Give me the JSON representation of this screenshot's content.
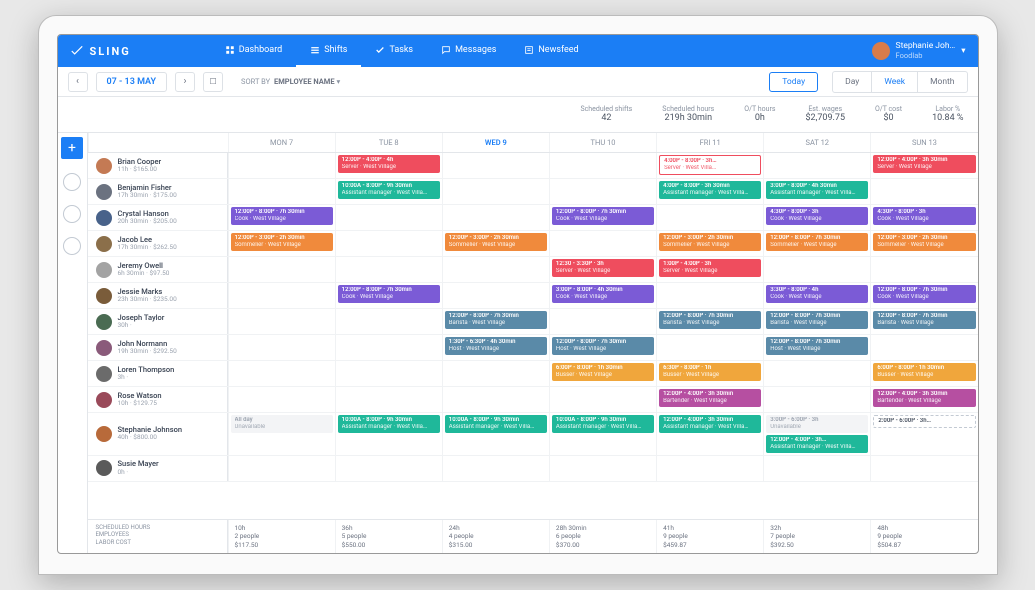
{
  "brand": "SLING",
  "nav": {
    "dashboard": "Dashboard",
    "shifts": "Shifts",
    "tasks": "Tasks",
    "messages": "Messages",
    "newsfeed": "Newsfeed"
  },
  "user": {
    "name": "Stephanie Joh…",
    "org": "Foodlab"
  },
  "toolbar": {
    "range": "07 - 13 MAY",
    "sort_label": "SORT BY",
    "sort_value": "EMPLOYEE NAME",
    "today": "Today",
    "day": "Day",
    "week": "Week",
    "month": "Month"
  },
  "stats": [
    {
      "label": "Scheduled shifts",
      "value": "42"
    },
    {
      "label": "Scheduled hours",
      "value": "219h 30min"
    },
    {
      "label": "O/T hours",
      "value": "0h"
    },
    {
      "label": "Est. wages",
      "value": "$2,709.75"
    },
    {
      "label": "O/T cost",
      "value": "$0"
    },
    {
      "label": "Labor %",
      "value": "10.84 %"
    }
  ],
  "days": [
    "MON 7",
    "TUE 8",
    "WED 9",
    "THU 10",
    "FRI 11",
    "SAT 12",
    "SUN 13"
  ],
  "colors": {
    "server": "#ef4d5e",
    "asst": "#1fb89a",
    "cook": "#7b5bd6",
    "somm": "#f08a3c",
    "barista": "#5a8aa8",
    "host": "#5a8aa8",
    "busser": "#f0a63c",
    "bartender": "#b64fa1"
  },
  "employees": [
    {
      "name": "Brian Cooper",
      "sub": "11h · $165.00",
      "av": "#c47a54",
      "cells": [
        [],
        [
          {
            "t": "12:00P - 4:00P · 4h",
            "r": "Server · West Village",
            "c": "server"
          }
        ],
        [],
        [],
        [
          {
            "t": "4:00P - 8:00P · 3h…",
            "r": "Server · West Villa…",
            "c": "server",
            "outline": true
          }
        ],
        [],
        [
          {
            "t": "12:00P - 4:00P · 3h 30min",
            "r": "Server · West Village",
            "c": "server"
          }
        ]
      ]
    },
    {
      "name": "Benjamin Fisher",
      "sub": "17h 30min · $175.00",
      "av": "#6b7280",
      "cells": [
        [],
        [
          {
            "t": "10:00A - 8:00P · 9h 30min",
            "r": "Assistant manager · West Villa…",
            "c": "asst"
          }
        ],
        [],
        [],
        [
          {
            "t": "4:00P - 8:00P · 3h 30min",
            "r": "Assistant manager · West Villa…",
            "c": "asst"
          }
        ],
        [
          {
            "t": "3:00P - 8:00P · 4h 30min",
            "r": "Assistant manager · West Villa…",
            "c": "asst"
          }
        ],
        []
      ]
    },
    {
      "name": "Crystal Hanson",
      "sub": "20h 30min · $205.00",
      "av": "#48628a",
      "cells": [
        [
          {
            "t": "12:00P - 8:00P · 7h 30min",
            "r": "Cook · West Village",
            "c": "cook"
          }
        ],
        [],
        [],
        [
          {
            "t": "12:00P - 8:00P · 7h 30min",
            "r": "Cook · West Village",
            "c": "cook"
          }
        ],
        [],
        [
          {
            "t": "4:30P - 8:00P · 3h",
            "r": "Cook · West Village",
            "c": "cook"
          }
        ],
        [
          {
            "t": "4:30P - 8:00P · 3h",
            "r": "Cook · West Village",
            "c": "cook"
          }
        ]
      ]
    },
    {
      "name": "Jacob Lee",
      "sub": "17h 30min · $262.50",
      "av": "#8b6f4a",
      "cells": [
        [
          {
            "t": "12:00P - 3:00P · 2h 30min",
            "r": "Sommelier · West Village",
            "c": "somm"
          }
        ],
        [],
        [
          {
            "t": "12:00P - 3:00P · 2h 30min",
            "r": "Sommelier · West Village",
            "c": "somm"
          }
        ],
        [],
        [
          {
            "t": "12:00P - 3:00P · 2h 30min",
            "r": "Sommelier · West Village",
            "c": "somm"
          }
        ],
        [
          {
            "t": "12:00P - 8:00P · 7h 30min",
            "r": "Sommelier · West Village",
            "c": "somm"
          }
        ],
        [
          {
            "t": "12:00P - 3:00P · 2h 30min",
            "r": "Sommelier · West Village",
            "c": "somm"
          }
        ]
      ]
    },
    {
      "name": "Jeremy Owell",
      "sub": "6h 30min · $97.50",
      "av": "#a3a3a3",
      "cells": [
        [],
        [],
        [],
        [
          {
            "t": "12:30 - 3:30P · 3h",
            "r": "Server · West Village",
            "c": "server"
          }
        ],
        [
          {
            "t": "1:00P - 4:00P · 3h",
            "r": "Server · West Village",
            "c": "server"
          }
        ],
        [],
        []
      ]
    },
    {
      "name": "Jessie Marks",
      "sub": "23h 30min · $235.00",
      "av": "#7a5c3a",
      "cells": [
        [],
        [
          {
            "t": "12:00P - 8:00P · 7h 30min",
            "r": "Cook · West Village",
            "c": "cook"
          }
        ],
        [],
        [
          {
            "t": "3:00P - 8:00P · 4h 30min",
            "r": "Cook · West Village",
            "c": "cook"
          }
        ],
        [],
        [
          {
            "t": "3:30P - 8:00P · 4h",
            "r": "Cook · West Village",
            "c": "cook"
          }
        ],
        [
          {
            "t": "12:00P - 8:00P · 7h 30min",
            "r": "Cook · West Village",
            "c": "cook"
          }
        ]
      ]
    },
    {
      "name": "Joseph Taylor",
      "sub": "30h ·",
      "av": "#4a6b52",
      "cells": [
        [],
        [],
        [
          {
            "t": "12:00P - 8:00P · 7h 30min",
            "r": "Barista · West Village",
            "c": "barista"
          }
        ],
        [],
        [
          {
            "t": "12:00P - 8:00P · 7h 30min",
            "r": "Barista · West Village",
            "c": "barista"
          }
        ],
        [
          {
            "t": "12:00P - 8:00P · 7h 30min",
            "r": "Barista · West Village",
            "c": "barista"
          }
        ],
        [
          {
            "t": "12:00P - 8:00P · 7h 30min",
            "r": "Barista · West Village",
            "c": "barista"
          }
        ]
      ]
    },
    {
      "name": "John Normann",
      "sub": "19h 30min · $292.50",
      "av": "#8a5a7a",
      "cells": [
        [],
        [],
        [
          {
            "t": "1:30P - 6:30P · 4h 30min",
            "r": "Host · West Village",
            "c": "host"
          }
        ],
        [
          {
            "t": "12:00P - 8:00P · 7h 30min",
            "r": "Host · West Village",
            "c": "host"
          }
        ],
        [],
        [
          {
            "t": "12:00P - 8:00P · 7h 30min",
            "r": "Host · West Village",
            "c": "host"
          }
        ],
        []
      ]
    },
    {
      "name": "Loren Thompson",
      "sub": "3h ·",
      "av": "#6b6b6b",
      "cells": [
        [],
        [],
        [],
        [
          {
            "t": "6:00P - 8:00P · 1h 30min",
            "r": "Busser · West Village",
            "c": "busser"
          }
        ],
        [
          {
            "t": "6:30P - 8:00P · 1h",
            "r": "Busser · West Village",
            "c": "busser"
          }
        ],
        [],
        [
          {
            "t": "6:00P - 8:00P · 1h 30min",
            "r": "Busser · West Village",
            "c": "busser"
          }
        ]
      ]
    },
    {
      "name": "Rose Watson",
      "sub": "10h · $129.75",
      "av": "#9a4a5a",
      "cells": [
        [],
        [],
        [],
        [],
        [
          {
            "t": "12:00P - 4:00P · 3h 30min",
            "r": "Bartender · West Village",
            "c": "bartender"
          }
        ],
        [],
        [
          {
            "t": "12:00P - 4:00P · 3h 30min",
            "r": "Bartender · West Village",
            "c": "bartender"
          }
        ]
      ]
    },
    {
      "name": "Stephanie Johnson",
      "sub": "40h · $800.00",
      "av": "#b86a3a",
      "cells": [
        [
          {
            "t": "All day",
            "r": "Unavailable",
            "unavail": true
          }
        ],
        [
          {
            "t": "10:00A - 8:00P · 9h 30min",
            "r": "Assistant manager · West Villa…",
            "c": "asst"
          }
        ],
        [
          {
            "t": "10:00A - 8:00P · 9h 30min",
            "r": "Assistant manager · West Villa…",
            "c": "asst"
          }
        ],
        [
          {
            "t": "10:00A - 8:00P · 9h 30min",
            "r": "Assistant manager · West Villa…",
            "c": "asst"
          }
        ],
        [
          {
            "t": "12:00P - 4:00P · 3h 30min",
            "r": "Assistant manager · West Villa…",
            "c": "asst"
          }
        ],
        [
          {
            "t": "3:00P - 6:00P · 3h",
            "r": "Unavailable",
            "unavail": true
          },
          {
            "t": "12:00P - 4:00P · 3h…",
            "r": "Assistant manager · West Villa…",
            "c": "asst"
          }
        ],
        [
          {
            "t": "2:00P - 6:00P · 3h…",
            "r": "",
            "pending": true
          }
        ]
      ]
    },
    {
      "name": "Susie Mayer",
      "sub": "0h ·",
      "av": "#5a5a5a",
      "cells": [
        [],
        [],
        [],
        [],
        [],
        [],
        []
      ]
    }
  ],
  "footer": {
    "labels": [
      "SCHEDULED HOURS",
      "EMPLOYEES",
      "LABOR COST"
    ],
    "cols": [
      {
        "hours": "10h",
        "emp": "2 people",
        "cost": "$117.50"
      },
      {
        "hours": "36h",
        "emp": "5 people",
        "cost": "$550.00"
      },
      {
        "hours": "24h",
        "emp": "4 people",
        "cost": "$315.00"
      },
      {
        "hours": "28h 30min",
        "emp": "6 people",
        "cost": "$370.00"
      },
      {
        "hours": "41h",
        "emp": "9 people",
        "cost": "$459.87"
      },
      {
        "hours": "32h",
        "emp": "7 people",
        "cost": "$392.50"
      },
      {
        "hours": "48h",
        "emp": "9 people",
        "cost": "$504.87"
      }
    ]
  }
}
